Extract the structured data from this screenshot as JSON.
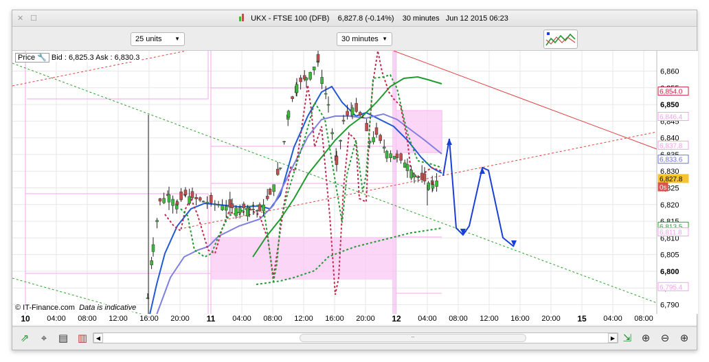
{
  "window": {
    "title": "UKX - FTSE 100 (DFB)",
    "price": "6,827.8 (-0.14%)",
    "interval": "30 minutes",
    "datetime": "Jun 12 2015 06:23",
    "close_glyph": "✕",
    "max_glyph": "☐"
  },
  "toolbar": {
    "units_select": "25 units",
    "interval_select": "30 minutes",
    "dropdown_arrow": "▼"
  },
  "pricebar": {
    "label": "Price",
    "bid_ask": "Bid : 6,825.3 Ask : 6,830.3"
  },
  "copyright": {
    "text": "© IT-Finance.com",
    "note": "Data is indicative"
  },
  "chart_data": {
    "type": "candlestick",
    "ylim": [
      6788,
      6865
    ],
    "y_ticks": [
      "6,860",
      "6,855",
      "6,850",
      "6,845",
      "6,840",
      "6,835",
      "6,830",
      "6,825",
      "6,820",
      "6,815",
      "6,810",
      "6,805",
      "6,800",
      "6,795",
      "6,790"
    ],
    "y_tick_values": [
      6860,
      6855,
      6850,
      6845,
      6840,
      6835,
      6830,
      6825,
      6820,
      6815,
      6810,
      6805,
      6800,
      6795,
      6790
    ],
    "x_ticks": [
      "10",
      "04:00",
      "08:00",
      "12:00",
      "16:00",
      "20:00",
      "11",
      "04:00",
      "08:00",
      "12:00",
      "16:00",
      "20:00",
      "12",
      "04:00",
      "08:00",
      "12:00",
      "16:00",
      "20:00",
      "15",
      "04:00",
      "08:00"
    ],
    "price_tags": [
      {
        "text": "6,854.0",
        "value": 6854.0,
        "color": "#cc1f3a"
      },
      {
        "text": "6,846.4",
        "value": 6846.4,
        "color": "#f4a0ee"
      },
      {
        "text": "6,837.8",
        "value": 6837.8,
        "color": "#f4a0ee"
      },
      {
        "text": "6,833.6",
        "value": 6833.6,
        "color": "#6f6fdf"
      },
      {
        "text": "6,827.8",
        "value": 6827.8,
        "color": "#f7c431"
      },
      {
        "text": "0s",
        "value": 6825.3,
        "color": "#d9534f"
      },
      {
        "text": "6,813.5",
        "value": 6813.5,
        "color": "#28a428"
      },
      {
        "text": "6,811.8",
        "value": 6811.8,
        "color": "#f4a0ee"
      },
      {
        "text": "6,795.4",
        "value": 6795.4,
        "color": "#f4a0ee"
      }
    ],
    "last_price": 6827.8,
    "bid": 6825.3,
    "ask": 6830.3
  },
  "bottombar": {
    "scroll_left": "◀",
    "scroll_right": "▶",
    "thumb": "┅"
  },
  "colors": {
    "bull_candle": "#3cb83c",
    "bear_candle": "#c0504d",
    "ma_fast": "#1f5ad6",
    "ma_slow": "#7f7fe0",
    "ma_long": "#1f9a2f",
    "projection": "#1a3fd6",
    "pivot": "#f4a6ee"
  }
}
